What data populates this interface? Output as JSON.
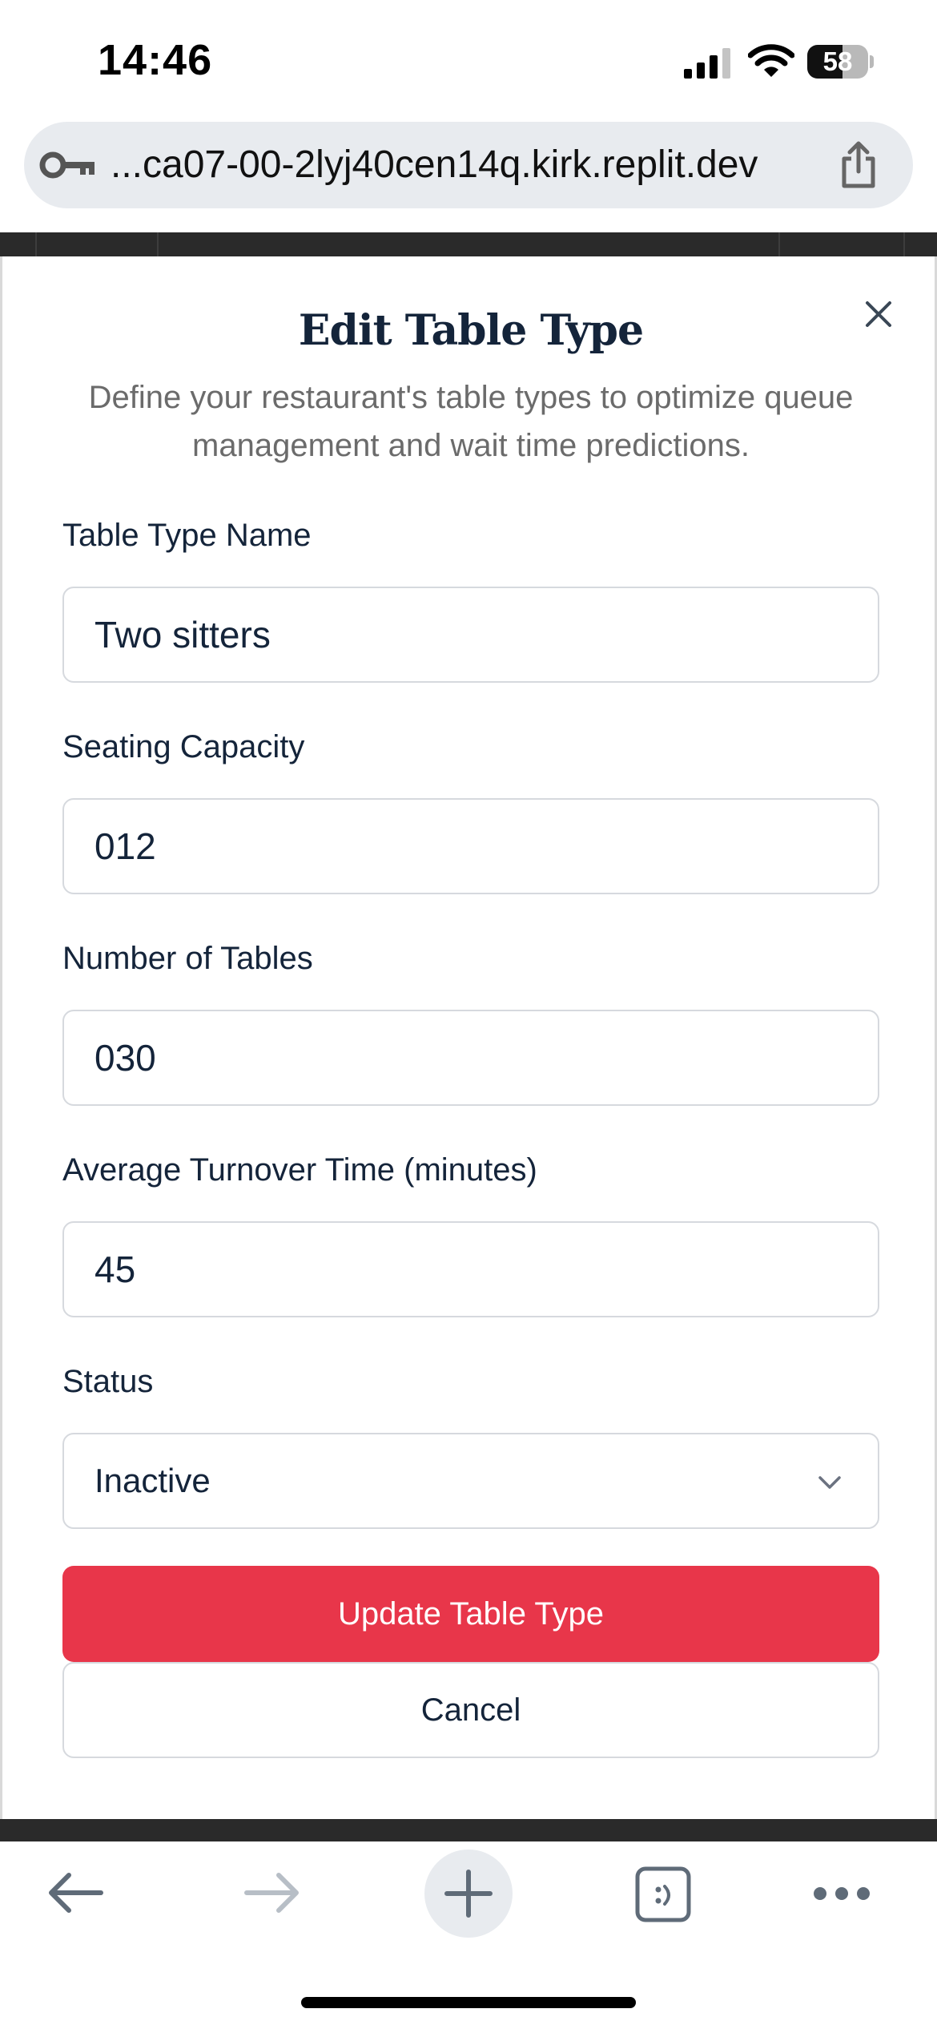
{
  "status_bar": {
    "time": "14:46",
    "battery_percent": "58",
    "battery_level": 0.58,
    "icons": [
      "cellular-signal-icon",
      "wifi-icon",
      "battery-icon"
    ]
  },
  "browser": {
    "url": "...ca07-00-2lyj40cen14q.kirk.replit.dev",
    "url_icons": [
      "key-icon",
      "share-icon"
    ],
    "toolbar_icons": [
      "back-arrow-icon",
      "forward-arrow-icon",
      "plus-icon",
      "tabs-icon",
      "more-icon"
    ]
  },
  "modal": {
    "title": "Edit Table Type",
    "description": "Define your restaurant's table types to optimize queue management and wait time predictions.",
    "fields": {
      "name": {
        "label": "Table Type Name",
        "value": "Two sitters"
      },
      "capacity": {
        "label": "Seating Capacity",
        "value": "012"
      },
      "tables": {
        "label": "Number of Tables",
        "value": "030"
      },
      "turnover": {
        "label": "Average Turnover Time (minutes)",
        "value": "45"
      },
      "status": {
        "label": "Status",
        "value": "Inactive"
      }
    },
    "buttons": {
      "submit": "Update Table Type",
      "cancel": "Cancel"
    }
  },
  "colors": {
    "primary": "#e8364a",
    "text_dark": "#14243a",
    "muted": "#6b6b6b",
    "border": "#d6d9de"
  }
}
